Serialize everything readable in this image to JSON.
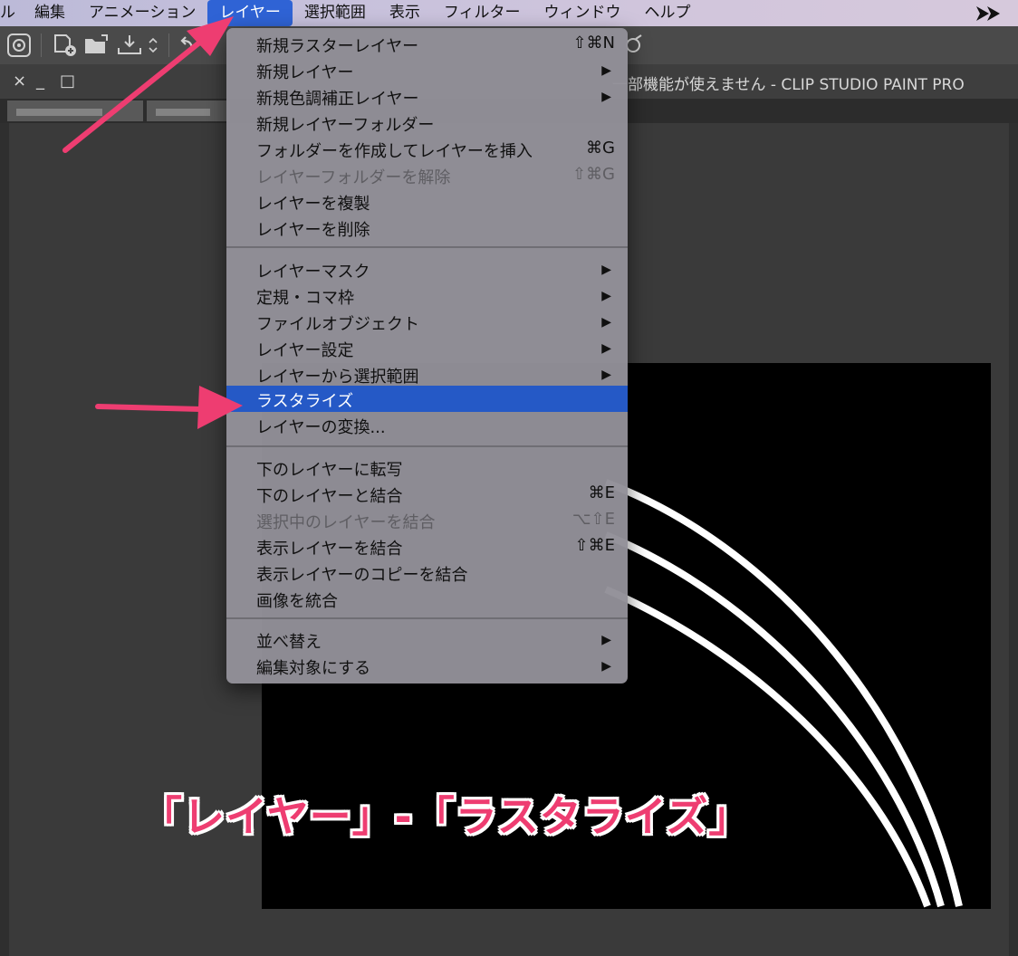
{
  "menubar": {
    "items": [
      {
        "label": "ル"
      },
      {
        "label": "編集"
      },
      {
        "label": "アニメーション"
      },
      {
        "label": "レイヤー"
      },
      {
        "label": "選択範囲"
      },
      {
        "label": "表示"
      },
      {
        "label": "フィルター"
      },
      {
        "label": "ウィンドウ"
      },
      {
        "label": "ヘルプ"
      }
    ],
    "active_label": "レイヤー"
  },
  "window": {
    "controls": [
      "×",
      "_",
      "□"
    ],
    "title": "一部機能が使えません - CLIP STUDIO PAINT PRO"
  },
  "layer_menu": {
    "sections": [
      [
        {
          "label": "新規ラスターレイヤー",
          "shortcut": "⇧⌘N"
        },
        {
          "label": "新規レイヤー",
          "submenu": "▶"
        },
        {
          "label": "新規色調補正レイヤー",
          "submenu": "▶"
        },
        {
          "label": "新規レイヤーフォルダー"
        },
        {
          "label": "フォルダーを作成してレイヤーを挿入",
          "shortcut": "⌘G"
        },
        {
          "label": "レイヤーフォルダーを解除",
          "shortcut": "⇧⌘G",
          "disabled": true
        },
        {
          "label": "レイヤーを複製"
        },
        {
          "label": "レイヤーを削除"
        }
      ],
      [
        {
          "label": "レイヤーマスク",
          "submenu": "▶"
        },
        {
          "label": "定規・コマ枠",
          "submenu": "▶"
        },
        {
          "label": "ファイルオブジェクト",
          "submenu": "▶"
        },
        {
          "label": "レイヤー設定",
          "submenu": "▶"
        },
        {
          "label": "レイヤーから選択範囲",
          "submenu": "▶"
        },
        {
          "label": "ラスタライズ",
          "highlighted": true
        },
        {
          "label": "レイヤーの変換..."
        }
      ],
      [
        {
          "label": "下のレイヤーに転写"
        },
        {
          "label": "下のレイヤーと結合",
          "shortcut": "⌘E"
        },
        {
          "label": "選択中のレイヤーを結合",
          "shortcut": "⌥⇧E",
          "disabled": true
        },
        {
          "label": "表示レイヤーを結合",
          "shortcut": "⇧⌘E"
        },
        {
          "label": "表示レイヤーのコピーを結合"
        },
        {
          "label": "画像を統合"
        }
      ],
      [
        {
          "label": "並べ替え",
          "submenu": "▶"
        },
        {
          "label": "編集対象にする",
          "submenu": "▶"
        }
      ]
    ]
  },
  "caption": {
    "text": "「レイヤー」-「ラスタライズ」"
  },
  "colors": {
    "menu_highlight": "#2559c6",
    "menubar_active": "#2f63d5",
    "annotation_pink": "#ee3d71",
    "canvas": "#000000"
  },
  "icons": [
    "clip-studio-icon",
    "new-file-icon",
    "open-folder-icon",
    "save-icon",
    "dropdown-chevron-icon",
    "undo-icon",
    "app-logo-icon"
  ]
}
